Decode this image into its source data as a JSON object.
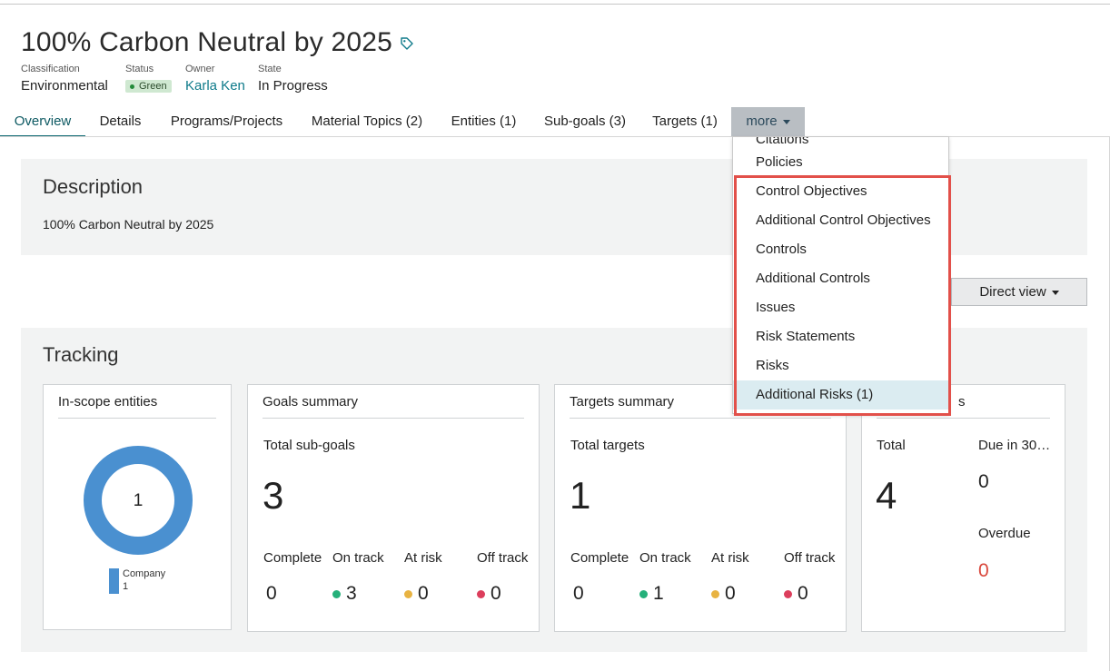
{
  "page": {
    "title": "100% Carbon Neutral by 2025",
    "tag_icon": "tag-icon"
  },
  "meta": {
    "classification": {
      "label": "Classification",
      "value": "Environmental"
    },
    "status": {
      "label": "Status",
      "value": "Green",
      "color": "#238a3a"
    },
    "owner": {
      "label": "Owner",
      "value": "Karla Ken"
    },
    "state": {
      "label": "State",
      "value": "In Progress"
    }
  },
  "tabs": [
    {
      "label": "Overview",
      "active": true
    },
    {
      "label": "Details"
    },
    {
      "label": "Programs/Projects"
    },
    {
      "label": "Material Topics (2)"
    },
    {
      "label": "Entities (1)"
    },
    {
      "label": "Sub-goals (3)"
    },
    {
      "label": "Targets (1)"
    },
    {
      "label": "more"
    }
  ],
  "description": {
    "heading": "Description",
    "text": "100% Carbon Neutral by 2025"
  },
  "view_selector": {
    "label": "Direct view"
  },
  "tracking": {
    "heading": "Tracking",
    "in_scope": {
      "title": "In-scope entities",
      "center_value": "1",
      "legend_label": "Company",
      "legend_value": "1",
      "color": "#4a90d0"
    },
    "goals": {
      "title": "Goals summary",
      "total_label": "Total sub-goals",
      "total": "3",
      "stats": [
        {
          "label": "Complete",
          "value": "0"
        },
        {
          "label": "On track",
          "value": "3",
          "color": "#25b07a"
        },
        {
          "label": "At risk",
          "value": "0",
          "color": "#e8b342"
        },
        {
          "label": "Off track",
          "value": "0",
          "color": "#dc3e5c"
        }
      ]
    },
    "targets": {
      "title": "Targets summary",
      "total_label": "Total targets",
      "total": "1",
      "stats": [
        {
          "label": "Complete",
          "value": "0"
        },
        {
          "label": "On track",
          "value": "1",
          "color": "#25b07a"
        },
        {
          "label": "At risk",
          "value": "0",
          "color": "#e8b342"
        },
        {
          "label": "Off track",
          "value": "0",
          "color": "#dc3e5c"
        }
      ]
    },
    "fourth": {
      "title_tail": "s",
      "total_label": "Total",
      "total": "4",
      "due_label": "Due in 30…",
      "due_value": "0",
      "overdue_label": "Overdue",
      "overdue_value": "0",
      "overdue_color": "#d9473b"
    }
  },
  "more_menu": {
    "partial_item": "Citations",
    "items": [
      "Policies",
      "Control Objectives",
      "Additional Control Objectives",
      "Controls",
      "Additional Controls",
      "Issues",
      "Risk Statements",
      "Risks",
      "Additional Risks (1)"
    ],
    "selected": "Additional Risks (1)",
    "highlight_color": "#e2504a"
  }
}
